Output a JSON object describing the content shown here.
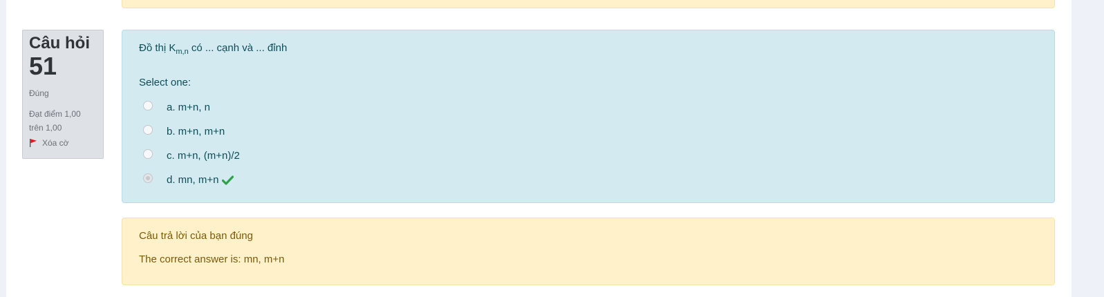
{
  "question_info": {
    "label": "Câu hỏi",
    "number": "51",
    "state": "Đúng",
    "grade_line1": "Đạt điểm 1,00",
    "grade_line2": "trên 1,00",
    "flag_label": "Xóa cờ",
    "flag_icon": "flag-icon",
    "flag_color": "#e0191f"
  },
  "question": {
    "text_before": "Đồ thị K",
    "text_sub": "m,n",
    "text_after": " có ... cạnh và ... đỉnh",
    "prompt": "Select one:",
    "options": [
      {
        "label": "a. m+n, n",
        "checked": false
      },
      {
        "label": "b. m+n, m+n",
        "checked": false
      },
      {
        "label": "c. m+n, (m+n)/2",
        "checked": false
      },
      {
        "label": "d. mn, m+n",
        "checked": true,
        "correct_icon": "check-icon"
      }
    ],
    "correct_color": "#2fa14a"
  },
  "outcome": {
    "feedback": "Câu trả lời của bạn đúng",
    "right_answer": "The correct answer is: mn, m+n"
  }
}
